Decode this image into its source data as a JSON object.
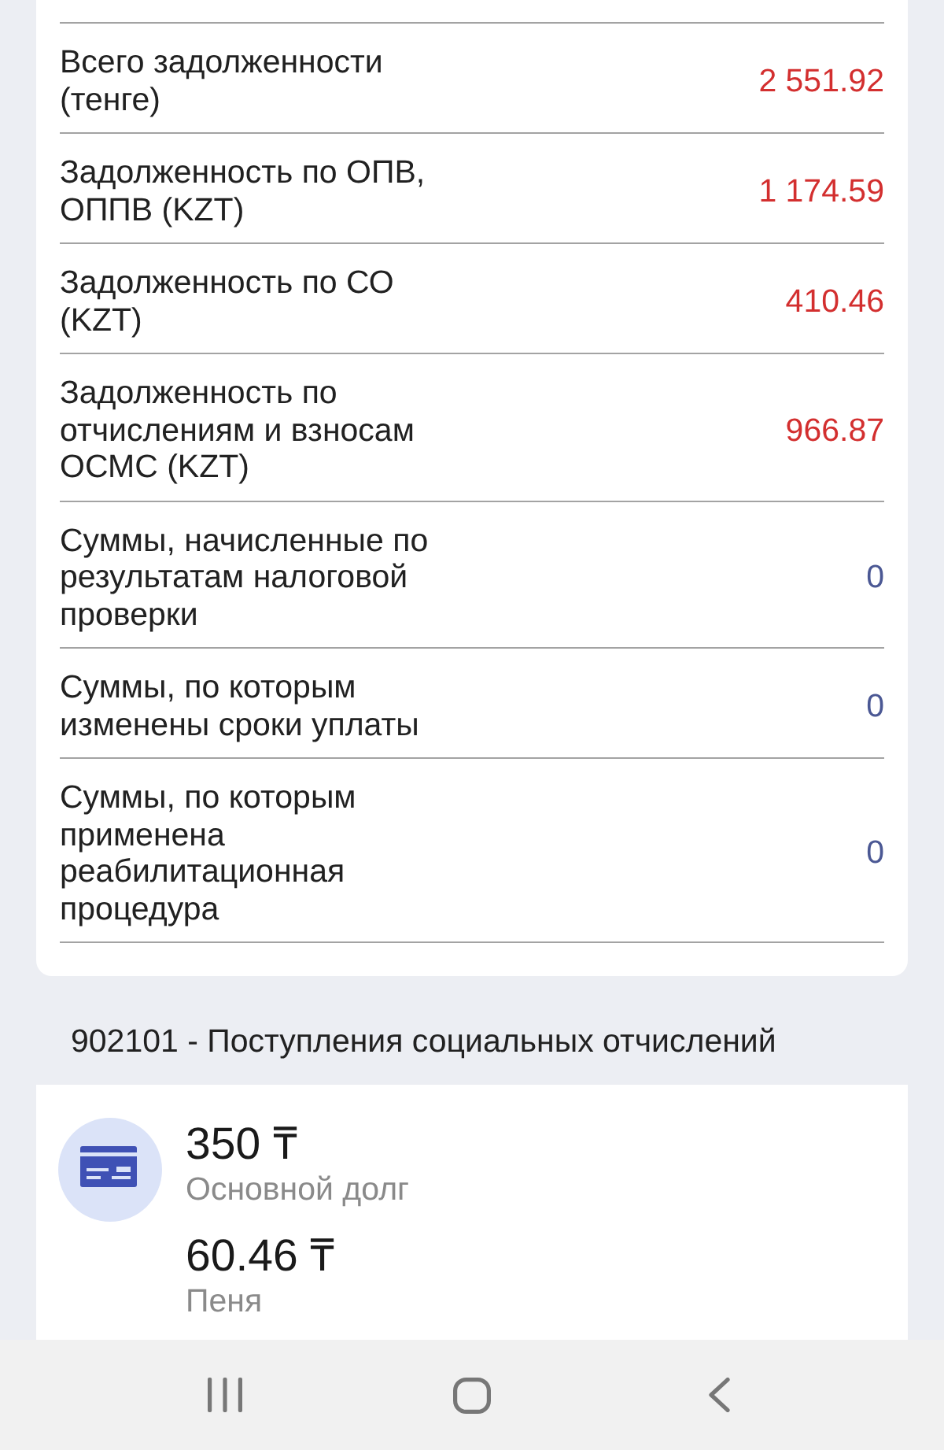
{
  "debt_table": {
    "rows": [
      {
        "label": "Всего задолженности\n(тенге)",
        "value": "2 551.92",
        "color": "#d32f2f"
      },
      {
        "label": "Задолженность по ОПВ,\nОППВ (KZT)",
        "value": "1 174.59",
        "color": "#d32f2f"
      },
      {
        "label": "Задолженность по СО\n(KZT)",
        "value": "410.46",
        "color": "#d32f2f"
      },
      {
        "label": "Задолженность по\nотчислениям и взносам\nОСМС (KZT)",
        "value": "966.87",
        "color": "#d32f2f"
      },
      {
        "label": "Суммы, начисленные по\nрезультатам налоговой\nпроверки",
        "value": "0",
        "color": "#4b5894"
      },
      {
        "label": "Суммы, по которым\nизменены сроки уплаты",
        "value": "0",
        "color": "#4b5894"
      },
      {
        "label": "Суммы, по которым\nприменена\nреабилитационная\nпроцедура",
        "value": "0",
        "color": "#4b5894"
      }
    ]
  },
  "section": {
    "title": "902101 - Поступления социальных отчислений"
  },
  "payment_card": {
    "items": [
      {
        "amount": "350 ₸",
        "caption": "Основной долг"
      },
      {
        "amount": "60.46 ₸",
        "caption": "Пеня"
      }
    ]
  },
  "nav_bar": {
    "buttons": [
      {
        "kind": "recents"
      },
      {
        "kind": "home"
      },
      {
        "kind": "back"
      }
    ]
  }
}
